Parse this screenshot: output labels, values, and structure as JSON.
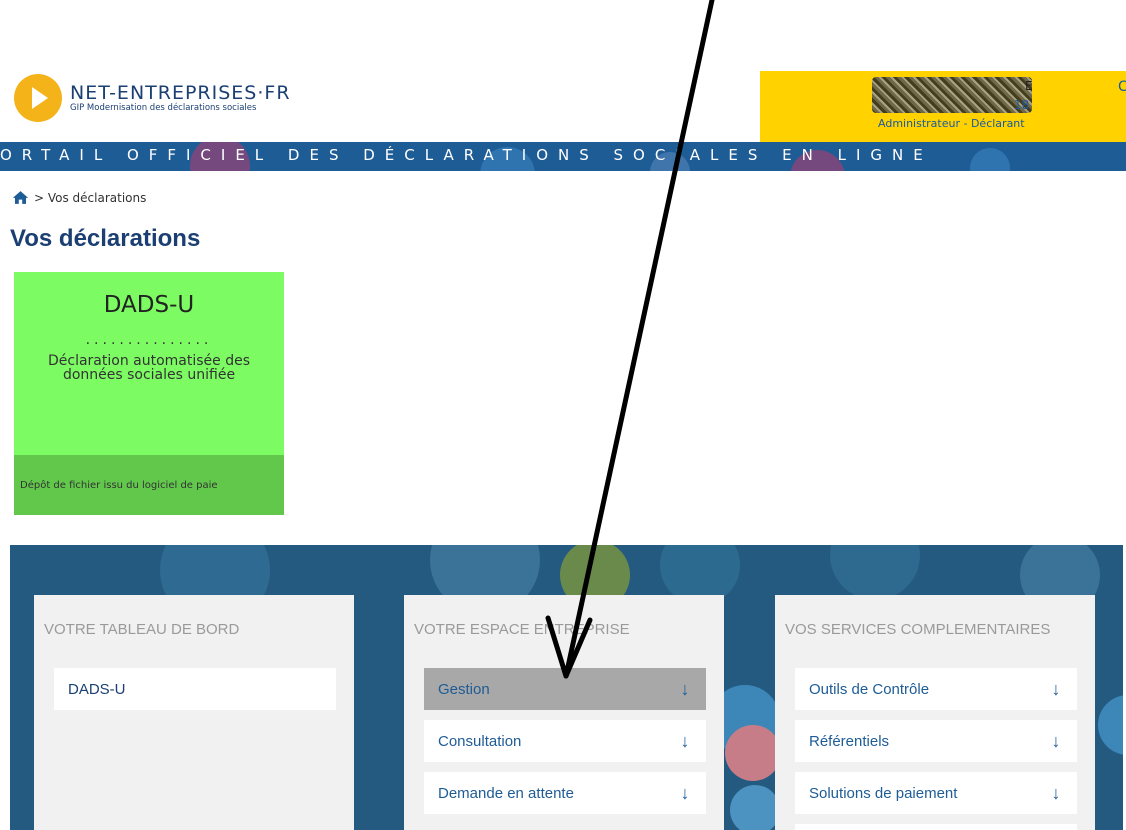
{
  "header": {
    "logo_title": "NET-ENTREPRISES·FR",
    "logo_subtitle": "GIP Modernisation des déclarations sociales",
    "user_name_partial": "E",
    "user_id_partial": "18",
    "user_role": "Administrateur - Déclarant",
    "user_extra": "C",
    "portal_banner": "ORTAIL OFFICIEL DES DÉCLARATIONS SOCIALES EN LIGNE"
  },
  "breadcrumb": {
    "text": "> Vos déclarations"
  },
  "page": {
    "title": "Vos déclarations"
  },
  "tile": {
    "title": "DADS-U",
    "dots": "...............",
    "description_line1": "Déclaration automatisée des",
    "description_line2": "données sociales unifiée",
    "footer": "Dépôt de fichier issu du logiciel de paie"
  },
  "panels": {
    "left": {
      "title": "VOTRE TABLEAU DE BORD",
      "items": [
        {
          "label": "DADS-U"
        }
      ]
    },
    "middle": {
      "title": "VOTRE ESPACE ENTREPRISE",
      "items": [
        {
          "label": "Gestion",
          "arrow": "↓"
        },
        {
          "label": "Consultation",
          "arrow": "↓"
        },
        {
          "label": "Demande en attente",
          "arrow": "↓"
        }
      ]
    },
    "right": {
      "title": "VOS SERVICES COMPLEMENTAIRES",
      "items": [
        {
          "label": "Outils de Contrôle",
          "arrow": "↓"
        },
        {
          "label": "Référentiels",
          "arrow": "↓"
        },
        {
          "label": "Solutions de paiement",
          "arrow": "↓"
        }
      ]
    }
  },
  "colors": {
    "brand_blue": "#1e5c96",
    "logo_orange": "#f5b31a",
    "user_box_yellow": "#ffd200",
    "tile_green": "#7cfc62",
    "tile_footer_green": "#61c84c",
    "active_item_grey": "#a8a8a8"
  },
  "icons": {
    "home": "home-icon",
    "logo": "play-logo-icon",
    "item_arrow": "arrow-down-icon"
  }
}
